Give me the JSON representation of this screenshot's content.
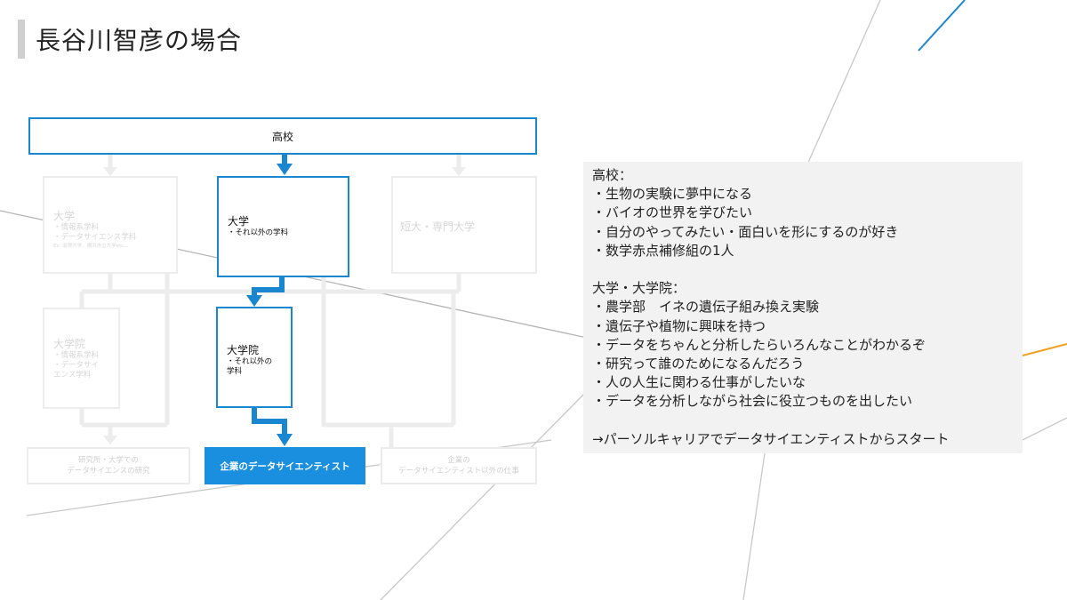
{
  "title": "長谷川智彦の場合",
  "flow": {
    "top": "高校",
    "univ_left": {
      "title": "大学",
      "lines": [
        "・情報系学科",
        "・データサイエンス学科"
      ],
      "note": "Ex. 滋賀大学、横浜市立大学etc..."
    },
    "univ_center": {
      "title": "大学",
      "lines": [
        "・それ以外の学科"
      ]
    },
    "junior": "短大・専門大学",
    "grad_left": {
      "title": "大学院",
      "lines": [
        "・情報系学科",
        "・データサイ",
        "エンス学科"
      ]
    },
    "grad_center": {
      "title": "大学院",
      "lines": [
        "・それ以外の",
        "学科"
      ]
    },
    "research": [
      "研究所・大学での",
      "データサイエンスの研究"
    ],
    "final": "企業のデータサイエンティスト",
    "other": [
      "企業の",
      "データサイエンティスト以外の仕事"
    ]
  },
  "notes": [
    "高校：",
    "・生物の実験に夢中になる",
    "・バイオの世界を学びたい",
    "・自分のやってみたい・面白いを形にするのが好き",
    "・数学赤点補修組の1人",
    "",
    "大学・大学院：",
    "・農学部　イネの遺伝子組み換え実験",
    "・遺伝子や植物に興味を持つ",
    "・データをちゃんと分析したらいろんなことがわかるぞ",
    "・研究って誰のためになるんだろう",
    "・人の人生に関わる仕事がしたいな",
    "・データを分析しながら社会に役立つものを出したい",
    "",
    "→パーソルキャリアでデータサイエンティストからスタート"
  ],
  "colors": {
    "accent": "#1a86d0",
    "final_bg": "#1a8fe0",
    "faded": "#ececec",
    "panel": "#f2f2f2"
  }
}
